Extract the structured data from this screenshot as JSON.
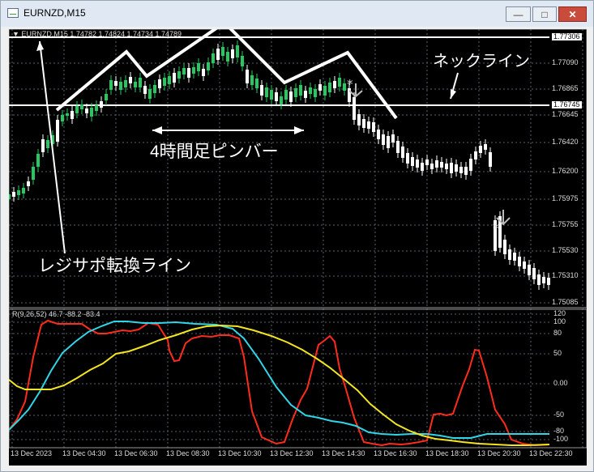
{
  "window": {
    "title": "EURNZD,M15",
    "minimize": "—",
    "maximize": "□",
    "close": "✕"
  },
  "main_chart": {
    "info": "▼ EURNZD,M15  1.74782 1.74824 1.74734 1.74789",
    "price_labels": [
      "1.77306",
      "1.77090",
      "1.76865",
      "1.76745",
      "1.76645",
      "1.76420",
      "1.76200",
      "1.75975",
      "1.75755",
      "1.75530",
      "1.75310",
      "1.75085"
    ],
    "highlighted_levels": [
      "1.77306",
      "1.76745"
    ],
    "annotations": {
      "neckline": "ネックライン",
      "pinbar": "4時間足ピンバー",
      "resistance_support": "レジサポ転換ライン"
    }
  },
  "indicator": {
    "title": "R(9,26,52) 46.7 -88.2 -83.4",
    "scale": [
      "120",
      "100",
      "80",
      "50",
      "0.00",
      "-50",
      "-80",
      "-100"
    ]
  },
  "time_axis": [
    "13 Dec 2023",
    "13 Dec 04:30",
    "13 Dec 06:30",
    "13 Dec 08:30",
    "13 Dec 10:30",
    "13 Dec 12:30",
    "13 Dec 14:30",
    "13 Dec 16:30",
    "13 Dec 18:30",
    "13 Dec 20:30",
    "13 Dec 22:30"
  ],
  "colors": {
    "up": "#27c85f",
    "down": "#ffffff",
    "red": "#ff2b1c",
    "cyan": "#2fd6e8",
    "yellow": "#f3e51f",
    "grid": "#56606a"
  }
}
